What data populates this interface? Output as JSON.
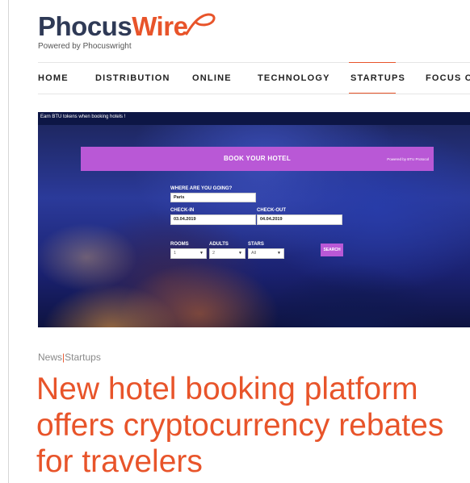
{
  "logo": {
    "part1": "Phocus",
    "part2": "Wire",
    "tagline": "Powered by Phocuswright"
  },
  "nav": {
    "items": [
      {
        "label": "HOME"
      },
      {
        "label": "DISTRIBUTION"
      },
      {
        "label": "ONLINE"
      },
      {
        "label": "TECHNOLOGY"
      },
      {
        "label": "STARTUPS",
        "active": true
      },
      {
        "label": "FOCUS ON"
      }
    ]
  },
  "hero": {
    "banner_text": "Earn BTU tokens when booking hotels !",
    "widget": {
      "title": "BOOK YOUR HOTEL",
      "powered": "Powered by BTU Protocol",
      "destination_label": "WHERE ARE YOU GOING?",
      "destination_value": "Paris",
      "checkin_label": "CHECK-IN",
      "checkin_value": "03.04.2019",
      "checkout_label": "CHECK-OUT",
      "checkout_value": "04.04.2019",
      "rooms_label": "ROOMS",
      "rooms_value": "1",
      "adults_label": "ADULTS",
      "adults_value": "2",
      "stars_label": "STARS",
      "stars_value": "All",
      "search_label": "SEARCH"
    }
  },
  "article": {
    "category1": "News",
    "separator": "|",
    "category2": "Startups",
    "headline": "New hotel booking platform offers cryptocurrency rebates for travelers"
  },
  "colors": {
    "accent": "#e8542a",
    "navy": "#2f3a56",
    "widget": "#b958d6"
  }
}
